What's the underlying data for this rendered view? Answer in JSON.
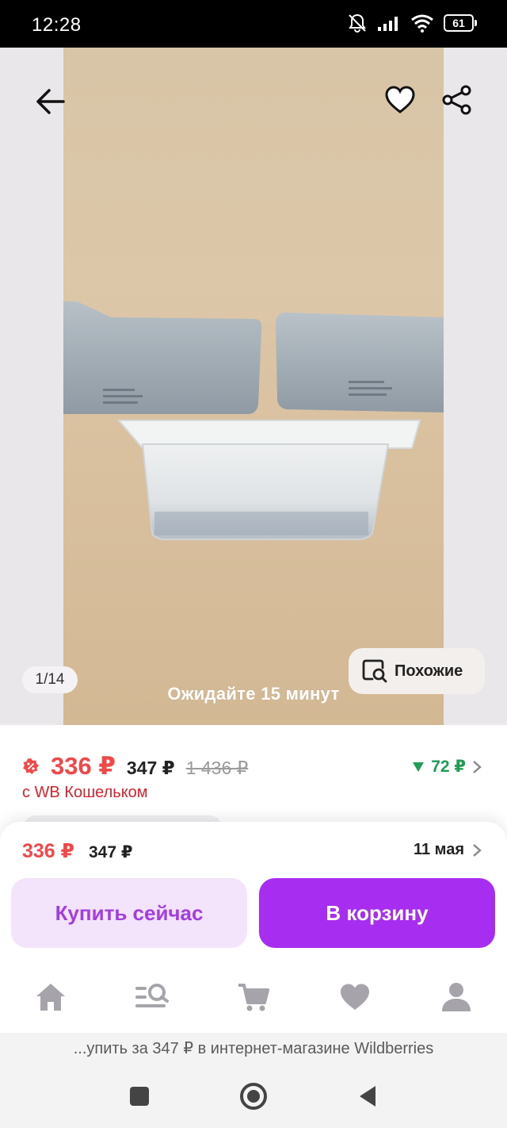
{
  "status_bar": {
    "time": "12:28",
    "battery": "61",
    "icons": [
      "bell-muted-icon",
      "signal-icon",
      "wifi-icon",
      "battery-icon"
    ]
  },
  "gallery": {
    "counter": "1/14",
    "similar_label": "Похожие",
    "overlay_text": "Ожидайте 15 минут"
  },
  "price": {
    "wallet_price": "336 ₽",
    "regular_price": "347 ₽",
    "old_price": "1 436 ₽",
    "wallet_label": "с WB Кошельком",
    "cashback": "72 ₽"
  },
  "buy_sheet": {
    "price": "336 ₽",
    "regular_price": "347 ₽",
    "delivery_date": "11 мая",
    "buy_now_label": "Купить сейчас",
    "add_to_cart_label": "В корзину"
  },
  "tabs": [
    {
      "icon": "home-icon"
    },
    {
      "icon": "catalog-search-icon"
    },
    {
      "icon": "cart-icon"
    },
    {
      "icon": "heart-icon"
    },
    {
      "icon": "profile-icon"
    }
  ],
  "browser_caption": "...упить за 347 ₽ в интернет-магазине Wildberries",
  "colors": {
    "accent": "#a72ef0",
    "accent_light": "#f3e3fb",
    "price_red": "#f04848",
    "cashback_green": "#1f9d55"
  }
}
